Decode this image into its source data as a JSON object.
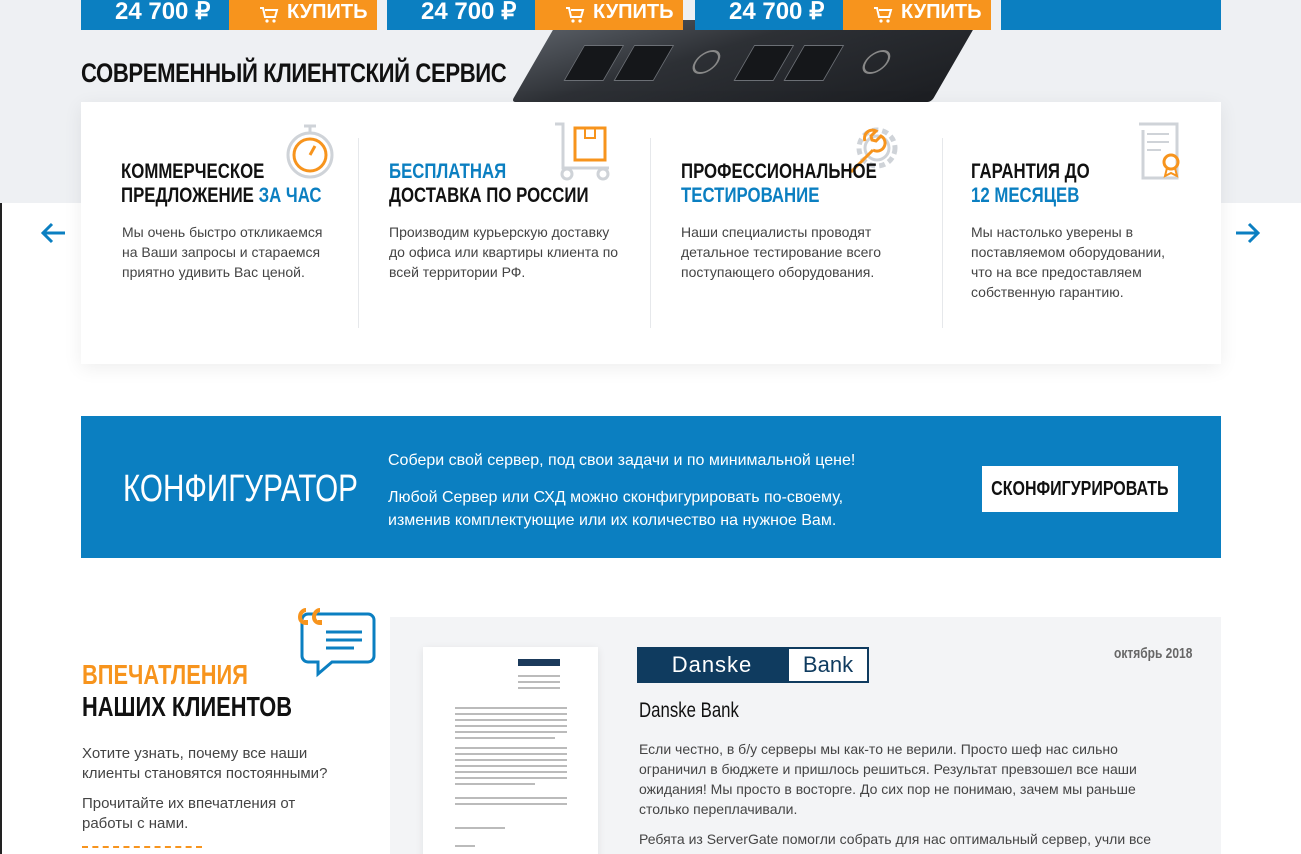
{
  "products": [
    {
      "price": "24 700 ₽",
      "buy_label": "КУПИТЬ"
    },
    {
      "price": "24 700 ₽",
      "buy_label": "КУПИТЬ"
    },
    {
      "price": "24 700 ₽",
      "buy_label": "КУПИТЬ"
    }
  ],
  "service": {
    "title": "СОВРЕМЕННЫЙ КЛИЕНТСКИЙ СЕРВИС",
    "features": [
      {
        "title_a": "КОММЕРЧЕСКОЕ",
        "title_b": "ПРЕДЛОЖЕНИЕ ",
        "title_accent": "ЗА ЧАС",
        "text": "Мы очень быстро откликаемся на Ваши запросы и стараемся приятно удивить Вас ценой.",
        "icon": "stopwatch-icon"
      },
      {
        "title_accent": "БЕСПЛАТНАЯ",
        "title_b": "ДОСТАВКА ПО РОССИИ",
        "text": "Производим курьерскую доставку до офиса или квартиры клиента по всей территории РФ.",
        "icon": "hand-truck-icon"
      },
      {
        "title_a": "ПРОФЕССИОНАЛЬНОЕ",
        "title_accent": "ТЕСТИРОВАНИЕ",
        "text": "Наши специалисты проводят детальное тестирование всего поступающего оборудования.",
        "icon": "wrench-gear-icon"
      },
      {
        "title_a": "ГАРАНТИЯ ДО",
        "title_accent": "12 МЕСЯЦЕВ",
        "text": "Мы настолько уверены в поставляемом оборудовании, что на все предоставляем собственную гарантию.",
        "icon": "certificate-icon"
      }
    ]
  },
  "configurator": {
    "title": "КОНФИГУРАТОР",
    "line1": "Собери свой сервер, под свои задачи и по минимальной цене!",
    "line2": "Любой Сервер или СХД можно сконфигурировать по-своему, изменив комплектующие или их количество на нужное Вам.",
    "button": "СКОНФИГУРИРОВАТЬ"
  },
  "reviews": {
    "title_accent": "ВПЕЧАТЛЕНИЯ",
    "title": "НАШИХ КЛИЕНТОВ",
    "text1": "Хотите узнать, почему все наши клиенты становятся постоянными?",
    "text2": "Прочитайте их впечатления от работы с нами.",
    "review": {
      "logo_left": "Danske",
      "logo_right": "Bank",
      "date": "октябрь 2018",
      "company": "Danske Bank",
      "body1": "Если честно, в б/у серверы мы как-то не верили. Просто шеф нас сильно ограничил в бюджете и пришлось решиться. Результат превзошел все наши ожидания! Мы просто в восторге. До сих пор не понимаю, зачем мы раньше столько переплачивали.",
      "body2": "Ребята из ServerGate помогли собрать для нас оптимальный сервер, учли все"
    }
  },
  "colors": {
    "blue": "#0b7fc1",
    "orange": "#f7941d",
    "dark": "#111111"
  }
}
